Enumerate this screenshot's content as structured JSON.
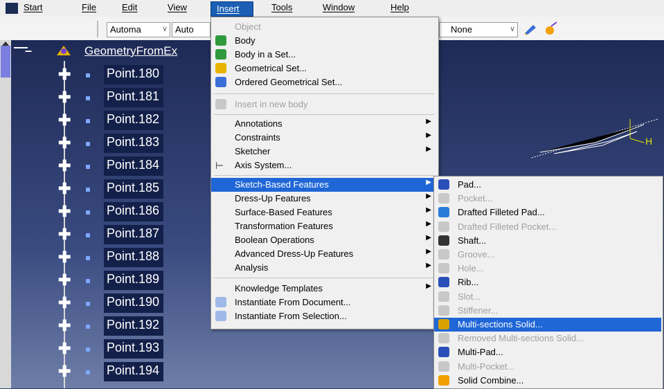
{
  "menubar": {
    "items": [
      "Start",
      "File",
      "Edit",
      "View",
      "Insert",
      "Tools",
      "Window",
      "Help"
    ]
  },
  "toolbar": {
    "combo1": "Automa",
    "combo2": "Auto",
    "combo3": "None"
  },
  "tree": {
    "root": "GeometryFromEx",
    "points": [
      "Point.180",
      "Point.181",
      "Point.182",
      "Point.183",
      "Point.184",
      "Point.185",
      "Point.186",
      "Point.187",
      "Point.188",
      "Point.189",
      "Point.190",
      "Point.192",
      "Point.193",
      "Point.194"
    ]
  },
  "insert_menu": {
    "object": "Object",
    "body": "Body",
    "body_in_set": "Body in a Set...",
    "geometrical_set": "Geometrical Set...",
    "ordered_geometrical_set": "Ordered Geometrical Set...",
    "insert_in_new_body": "Insert in new body",
    "annotations": "Annotations",
    "constraints": "Constraints",
    "sketcher": "Sketcher",
    "axis_system": "Axis System...",
    "sketch_based": "Sketch-Based Features",
    "dress_up": "Dress-Up Features",
    "surface_based": "Surface-Based Features",
    "transformation": "Transformation Features",
    "boolean": "Boolean Operations",
    "advanced_dress_up": "Advanced Dress-Up Features",
    "analysis": "Analysis",
    "knowledge_templates": "Knowledge Templates",
    "instantiate_document": "Instantiate From Document...",
    "instantiate_selection": "Instantiate From Selection..."
  },
  "sketch_submenu": {
    "items": [
      {
        "label": "Pad...",
        "enabled": true
      },
      {
        "label": "Pocket...",
        "enabled": false
      },
      {
        "label": "Drafted Filleted Pad...",
        "enabled": true
      },
      {
        "label": "Drafted Filleted Pocket...",
        "enabled": false
      },
      {
        "label": "Shaft...",
        "enabled": true
      },
      {
        "label": "Groove...",
        "enabled": false
      },
      {
        "label": "Hole...",
        "enabled": false
      },
      {
        "label": "Rib...",
        "enabled": true
      },
      {
        "label": "Slot...",
        "enabled": false
      },
      {
        "label": "Stiffener...",
        "enabled": false
      },
      {
        "label": "Multi-sections Solid...",
        "enabled": true
      },
      {
        "label": "Removed Multi-sections Solid...",
        "enabled": false
      },
      {
        "label": "Multi-Pad...",
        "enabled": true
      },
      {
        "label": "Multi-Pocket...",
        "enabled": false
      },
      {
        "label": "Solid Combine...",
        "enabled": true
      }
    ]
  },
  "viewport": {
    "axis_label": "H"
  },
  "colors": {
    "menu_highlight": "#1f66d6",
    "tree_bg": "#1e2a56"
  }
}
